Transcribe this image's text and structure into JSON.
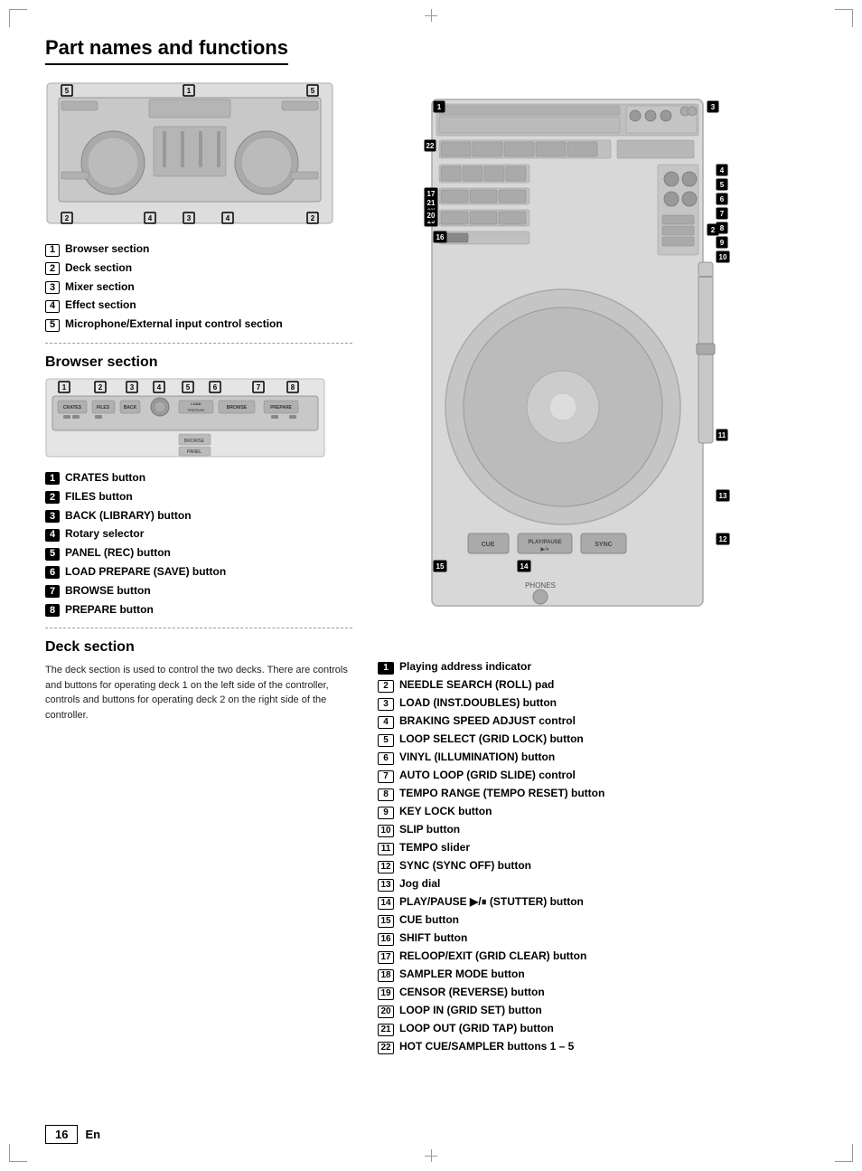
{
  "page": {
    "title": "Part names and functions",
    "footer": {
      "page_number": "16",
      "lang": "En"
    }
  },
  "overview_diagram": {
    "labels": [
      {
        "num": "5",
        "pos": "top-left"
      },
      {
        "num": "1",
        "pos": "top-center"
      },
      {
        "num": "5",
        "pos": "top-right"
      },
      {
        "num": "2",
        "pos": "bottom-left"
      },
      {
        "num": "4",
        "pos": "bottom-center-left"
      },
      {
        "num": "3",
        "pos": "bottom-center"
      },
      {
        "num": "4",
        "pos": "bottom-center-right"
      },
      {
        "num": "2",
        "pos": "bottom-right"
      }
    ]
  },
  "overview_items": [
    {
      "num": "1",
      "label": "Browser section"
    },
    {
      "num": "2",
      "label": "Deck section"
    },
    {
      "num": "3",
      "label": "Mixer section"
    },
    {
      "num": "4",
      "label": "Effect section"
    },
    {
      "num": "5",
      "label": "Microphone/External input control section"
    }
  ],
  "browser_section": {
    "title": "Browser section",
    "num_labels": [
      "1",
      "2",
      "3",
      "4",
      "5",
      "6",
      "7",
      "8"
    ],
    "items": [
      {
        "num": "1",
        "label": "CRATES button"
      },
      {
        "num": "2",
        "label": "FILES button"
      },
      {
        "num": "3",
        "label": "BACK (LIBRARY) button"
      },
      {
        "num": "4",
        "label": "Rotary selector"
      },
      {
        "num": "5",
        "label": "PANEL (REC) button"
      },
      {
        "num": "6",
        "label": "LOAD PREPARE (SAVE) button"
      },
      {
        "num": "7",
        "label": "BROWSE button"
      },
      {
        "num": "8",
        "label": "PREPARE button"
      }
    ]
  },
  "deck_section": {
    "title": "Deck section",
    "description": "The deck section is used to control the two decks. There are controls and buttons for operating deck 1 on the left side of the controller, controls and buttons for operating deck 2 on the right side of the controller."
  },
  "right_items": [
    {
      "num": "1",
      "label": "Playing address indicator"
    },
    {
      "num": "2",
      "label": "NEEDLE SEARCH (ROLL) pad"
    },
    {
      "num": "3",
      "label": "LOAD (INST.DOUBLES) button"
    },
    {
      "num": "4",
      "label": "BRAKING SPEED ADJUST control"
    },
    {
      "num": "5",
      "label": "LOOP SELECT (GRID LOCK) button"
    },
    {
      "num": "6",
      "label": "VINYL (ILLUMINATION) button"
    },
    {
      "num": "7",
      "label": "AUTO LOOP (GRID SLIDE) control"
    },
    {
      "num": "8",
      "label": "TEMPO RANGE (TEMPO RESET) button"
    },
    {
      "num": "9",
      "label": "KEY LOCK button"
    },
    {
      "num": "10",
      "label": "SLIP button"
    },
    {
      "num": "11",
      "label": "TEMPO slider"
    },
    {
      "num": "12",
      "label": "SYNC (SYNC OFF) button"
    },
    {
      "num": "13",
      "label": "Jog dial"
    },
    {
      "num": "14",
      "label": "PLAY/PAUSE ▶/⏸ (STUTTER) button"
    },
    {
      "num": "15",
      "label": "CUE button"
    },
    {
      "num": "16",
      "label": "SHIFT button"
    },
    {
      "num": "17",
      "label": "RELOOP/EXIT (GRID CLEAR) button"
    },
    {
      "num": "18",
      "label": "SAMPLER MODE button"
    },
    {
      "num": "19",
      "label": "CENSOR (REVERSE) button"
    },
    {
      "num": "20",
      "label": "LOOP IN (GRID SET) button"
    },
    {
      "num": "21",
      "label": "LOOP OUT (GRID TAP) button"
    },
    {
      "num": "22",
      "label": "HOT CUE/SAMPLER buttons 1 – 5"
    }
  ]
}
